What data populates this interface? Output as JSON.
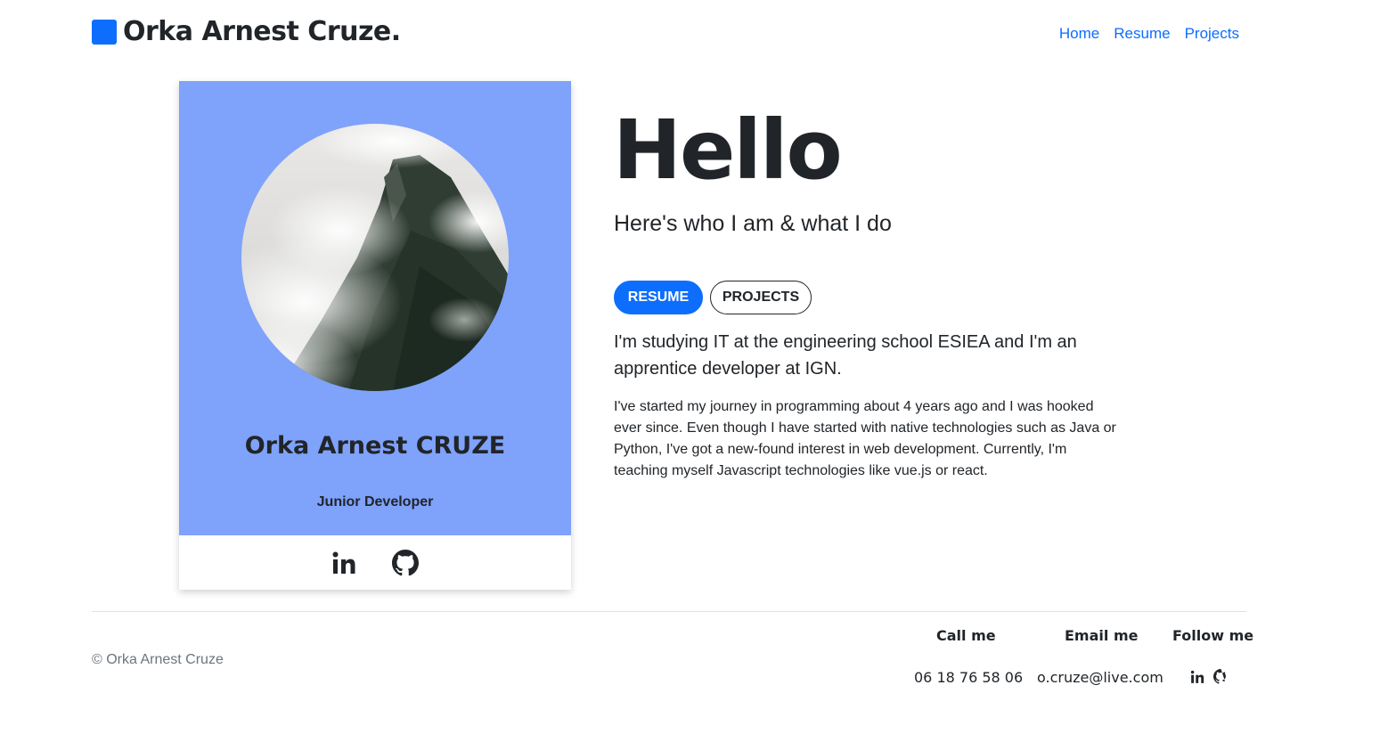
{
  "header": {
    "brand": "Orka Arnest Cruze.",
    "nav": [
      "Home",
      "Resume",
      "Projects"
    ]
  },
  "profile": {
    "name": "Orka Arnest CRUZE",
    "role": "Junior Developer",
    "social": [
      "linkedin-icon",
      "github-icon"
    ]
  },
  "intro": {
    "title": "Hello",
    "subtitle": "Here's who I am & what I do",
    "buttons": {
      "resume": "RESUME",
      "projects": "PROJECTS"
    },
    "lead": "I'm studying IT at the engineering school ESIEA and I'm an apprentice developer at IGN.",
    "body": "I've started my journey in programming about 4 years ago and I was hooked ever since. Even though I have started with native technologies such as Java or Python, I've got a new-found interest in web development. Currently, I'm teaching myself Javascript technologies like vue.js or react."
  },
  "footer": {
    "copyright": "© Orka Arnest Cruze",
    "call_label": "Call me",
    "call_value": "06 18 76 58 06",
    "email_label": "Email me",
    "email_value": "o.cruze@live.com",
    "follow_label": "Follow me"
  },
  "colors": {
    "accent": "#0d6efd",
    "card_bg": "#7fa2fb",
    "text": "#212529",
    "muted": "#6c757d"
  }
}
